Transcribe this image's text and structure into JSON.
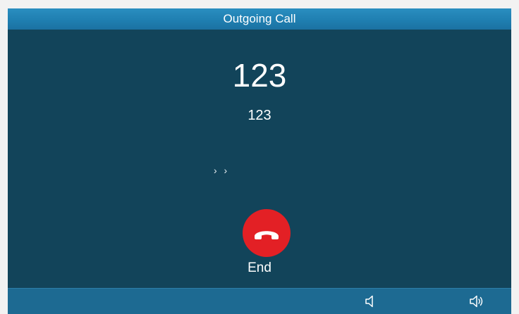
{
  "header": {
    "title": "Outgoing Call"
  },
  "call": {
    "name": "123",
    "number": "123",
    "status_glyph": "› ›"
  },
  "actions": {
    "end_label": "End",
    "end_icon": "hang-up-icon",
    "end_color": "#e32025"
  },
  "softkeys": [
    {
      "icon": "volume-down-icon"
    },
    {
      "icon": "volume-up-icon"
    }
  ],
  "colors": {
    "background": "#12445a",
    "header": "#1f7fb1",
    "footer": "#1d6a92"
  }
}
